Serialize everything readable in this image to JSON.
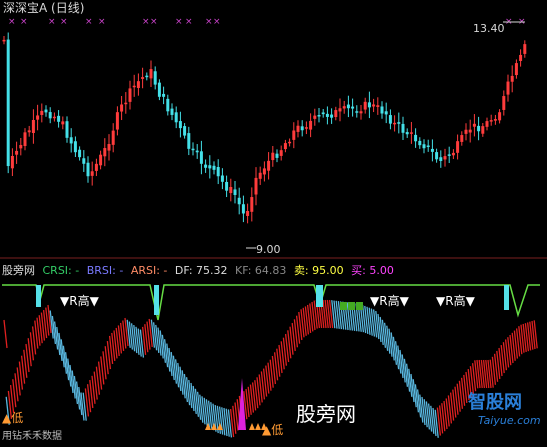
{
  "app": {
    "title": "深深宝A (日线)"
  },
  "price_chart": {
    "high_label": "13.40",
    "low_label": "9.00",
    "colors": {
      "up": "#ff3c3c",
      "down": "#44e0e8",
      "top_marks": "#cc44cc"
    }
  },
  "indicator": {
    "source": "股旁网",
    "crsi": {
      "label": "CRSI: -",
      "color": "#33cc66"
    },
    "brsi": {
      "label": "BRSI: -",
      "color": "#7a7aff"
    },
    "arsi": {
      "label": "ARSI: -",
      "color": "#ff8c66"
    },
    "df": {
      "label": "DF: 75.32",
      "color": "#dddddd"
    },
    "kf": {
      "label": "KF: 64.83",
      "color": "#888888"
    },
    "sell": {
      "label": "卖: 95.00",
      "color": "#ffff44"
    },
    "buy": {
      "label": "买: 5.00",
      "color": "#ff44ff"
    },
    "r_high_marks": [
      "▼R高▼",
      "▼R高▼",
      "▼R高▼"
    ],
    "low_marks": [
      "▲低",
      "▲低"
    ],
    "footer": "用钻禾禾数据"
  },
  "watermarks": {
    "site_cn": "股旁网",
    "site_logo": "智股网",
    "site_url": "Taiyue.com"
  }
}
